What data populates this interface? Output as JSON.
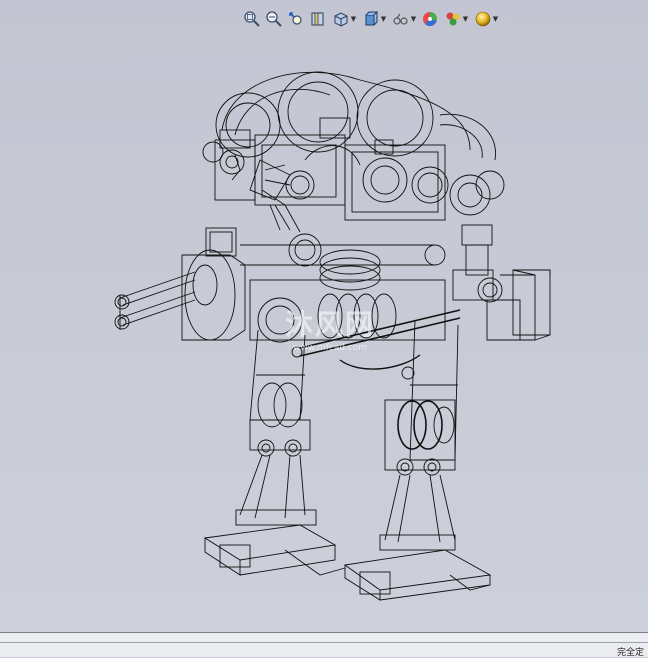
{
  "toolbar": {
    "buttons": [
      {
        "name": "zoom-to-fit-icon"
      },
      {
        "name": "zoom-to-area-icon"
      },
      {
        "name": "previous-view-icon"
      },
      {
        "name": "section-view-icon"
      },
      {
        "name": "view-orientation-icon",
        "dropdown": true
      },
      {
        "name": "display-style-icon",
        "dropdown": true
      },
      {
        "name": "hide-show-items-icon",
        "dropdown": true
      },
      {
        "name": "edit-appearance-icon"
      },
      {
        "name": "apply-scene-icon",
        "dropdown": true
      },
      {
        "name": "view-settings-icon",
        "dropdown": true
      }
    ]
  },
  "watermark": {
    "main": "沐风网",
    "sub": "www.mfcad.com"
  },
  "status_bar": {
    "text": "完全定"
  },
  "colors": {
    "viewport": "#c9ccd6",
    "wireframe": "#111111"
  }
}
